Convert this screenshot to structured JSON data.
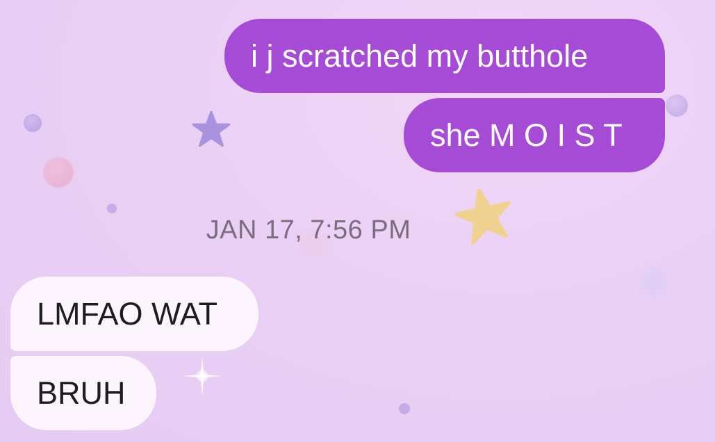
{
  "conversation": {
    "messages": [
      {
        "sender": "me",
        "text": "i j scratched my butthole"
      },
      {
        "sender": "me",
        "text": "she M O I S T"
      },
      {
        "sender": "them",
        "text": "LMFAO WAT"
      },
      {
        "sender": "them",
        "text": "BRUH"
      }
    ],
    "timestamp": "JAN 17, 7:56 PM"
  },
  "theme": {
    "outgoing_bubble_color": "#a64bd6",
    "incoming_bubble_color": "#fcf5fd",
    "background_color": "#ead0f5"
  },
  "icons": [
    "star-icon",
    "sparkle-icon"
  ]
}
